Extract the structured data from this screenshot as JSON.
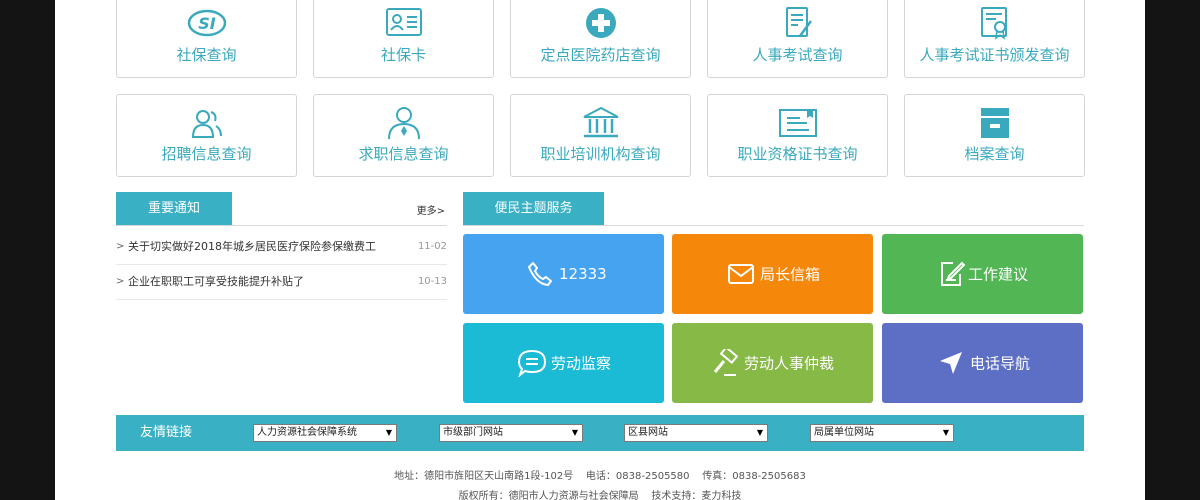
{
  "tiles": [
    {
      "label": "社保查询",
      "icon": "si-logo-icon"
    },
    {
      "label": "社保卡",
      "icon": "id-card-icon"
    },
    {
      "label": "定点医院药店查询",
      "icon": "medical-cross-icon"
    },
    {
      "label": "人事考试查询",
      "icon": "exam-paper-icon"
    },
    {
      "label": "人事考试证书颁发查询",
      "icon": "certificate-icon"
    },
    {
      "label": "招聘信息查询",
      "icon": "recruit-users-icon"
    },
    {
      "label": "求职信息查询",
      "icon": "job-seeker-icon"
    },
    {
      "label": "职业培训机构查询",
      "icon": "institution-icon"
    },
    {
      "label": "职业资格证书查询",
      "icon": "qualification-card-icon"
    },
    {
      "label": "档案查询",
      "icon": "archive-box-icon"
    }
  ],
  "notices": {
    "tab_label": "重要通知",
    "more_label": "更多>",
    "items": [
      {
        "title": "关于切实做好2018年城乡居民医疗保险参保缴费工",
        "date": "11-02"
      },
      {
        "title": "企业在职职工可享受技能提升补贴了",
        "date": "10-13"
      }
    ]
  },
  "services": {
    "tab_label": "便民主题服务",
    "buttons": [
      {
        "label": "12333",
        "icon": "phone-icon",
        "color": "#45a3f0"
      },
      {
        "label": "局长信箱",
        "icon": "mail-icon",
        "color": "#f5870a"
      },
      {
        "label": "工作建议",
        "icon": "edit-note-icon",
        "color": "#51b653"
      },
      {
        "label": "劳动监察",
        "icon": "chat-bubble-icon",
        "color": "#1bbbd6"
      },
      {
        "label": "劳动人事仲裁",
        "icon": "gavel-icon",
        "color": "#86b945"
      },
      {
        "label": "电话导航",
        "icon": "navigation-arrow-icon",
        "color": "#5c6fc4"
      }
    ]
  },
  "links": {
    "title": "友情链接",
    "selects": [
      "人力资源社会保障系统",
      "市级部门网站",
      "区县网站",
      "局属单位网站"
    ]
  },
  "footer": {
    "line1": "地址：德阳市旌阳区天山南路1段-102号    电话：0838-2505580    传真：0838-2505683",
    "line2": "版权所有：德阳市人力资源与社会保障局    技术支持：麦力科技"
  },
  "colors": {
    "accent": "#3ab0c5",
    "tile_text": "#3aa9bd"
  }
}
